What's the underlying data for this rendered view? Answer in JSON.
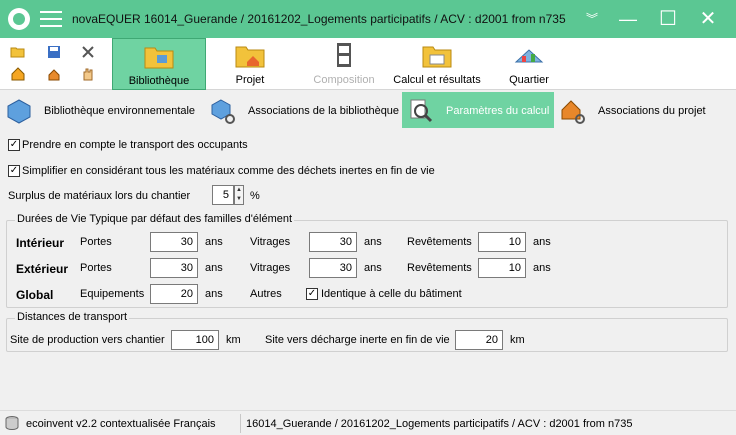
{
  "titlebar": {
    "app_name": "novaEQUER",
    "document": "16014_Guerande / 20161202_Logements participatifs / ACV : d2001 from n735",
    "chevron": "︾",
    "minimize": "—",
    "maximize": "☐",
    "close": "✕"
  },
  "ribbon": {
    "buttons": [
      {
        "label": "Bibliothèque",
        "active": true
      },
      {
        "label": "Projet"
      },
      {
        "label": "Composition",
        "disabled": true
      },
      {
        "label": "Calcul et résultats"
      },
      {
        "label": "Quartier"
      }
    ]
  },
  "tabs": [
    {
      "label": "Bibliothèque environnementale"
    },
    {
      "label": "Associations de la bibliothèque"
    },
    {
      "label": "Paramètres du calcul",
      "active": true
    },
    {
      "label": "Associations du projet"
    }
  ],
  "options": {
    "transport_occupants": "Prendre en compte le transport des occupants",
    "simplifier_dechets": "Simplifier en considérant tous les matériaux comme des déchets inertes en fin de vie",
    "surplus_label": "Surplus de matériaux lors du chantier",
    "surplus_value": "5",
    "surplus_unit": "%"
  },
  "durees": {
    "title": "Durées de Vie Typique par défaut des familles d'élément",
    "unit": "ans",
    "interieur": {
      "label": "Intérieur",
      "portes_label": "Portes",
      "portes": "30",
      "vitrages_label": "Vitrages",
      "vitrages": "30",
      "revetements_label": "Revêtements",
      "revetements": "10"
    },
    "exterieur": {
      "label": "Extérieur",
      "portes_label": "Portes",
      "portes": "30",
      "vitrages_label": "Vitrages",
      "vitrages": "30",
      "revetements_label": "Revêtements",
      "revetements": "10"
    },
    "global": {
      "label": "Global",
      "equipements_label": "Equipements",
      "equipements": "20",
      "autres_label": "Autres",
      "identique_label": "Identique à celle du bâtiment"
    }
  },
  "distances": {
    "title": "Distances de transport",
    "production_label": "Site de production vers chantier",
    "production_value": "100",
    "decharge_label": "Site vers décharge inerte en fin de vie",
    "decharge_value": "20",
    "unit": "km"
  },
  "status": {
    "database": "ecoinvent v2.2 contextualisée Français",
    "project": "16014_Guerande / 20161202_Logements participatifs / ACV : d2001 from n735"
  }
}
